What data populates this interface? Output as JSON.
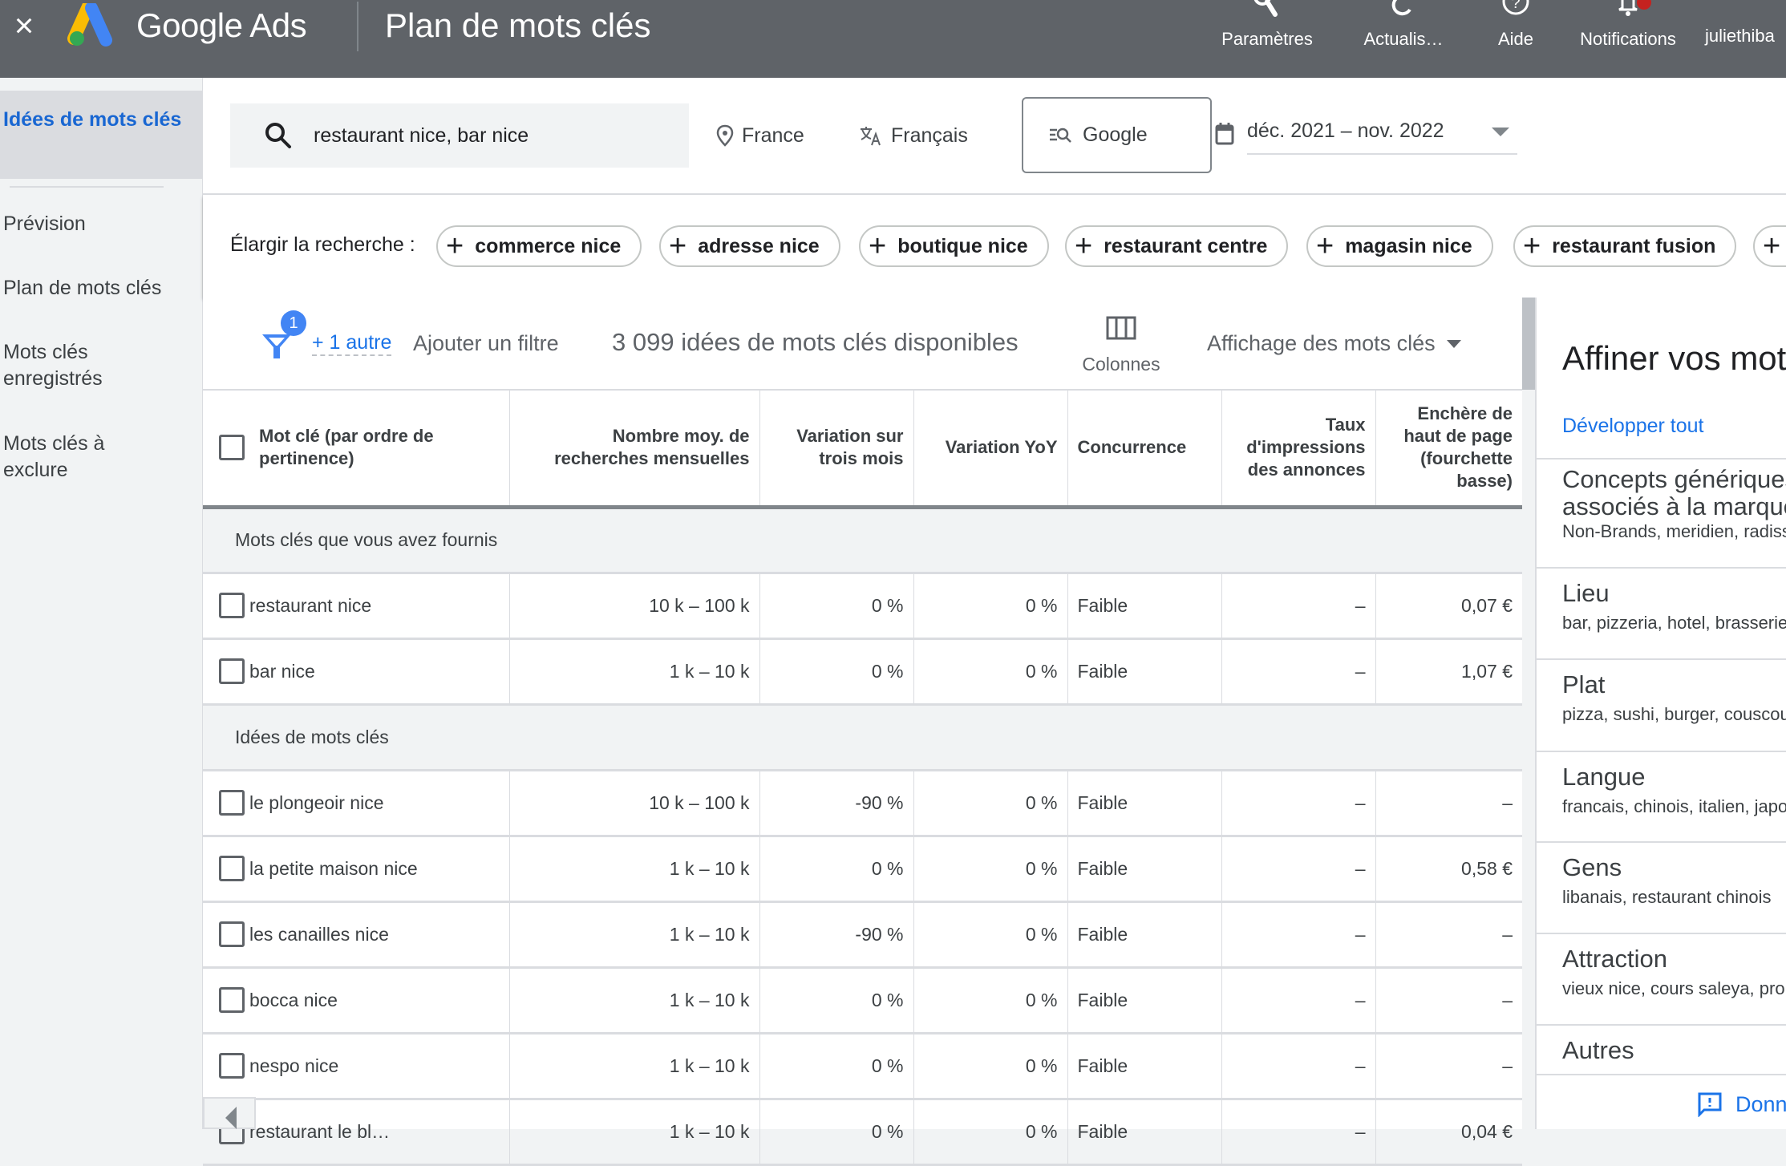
{
  "topbar": {
    "close_label": "×",
    "brand": "Google Ads",
    "page_title": "Plan de mots clés",
    "actions": [
      {
        "label": "Paramètres",
        "icon": "wrench-icon"
      },
      {
        "label": "Actualis…",
        "icon": "refresh-icon"
      },
      {
        "label": "Aide",
        "icon": "help-icon"
      },
      {
        "label": "Notifications",
        "icon": "bell-icon"
      }
    ],
    "user": "juliethiba"
  },
  "sidebar": {
    "items": [
      {
        "label": "Idées de mots clés",
        "active": true
      },
      {
        "label": "Prévision",
        "active": false
      },
      {
        "label": "Plan de mots clés",
        "active": false
      },
      {
        "label": "Mots clés enregistrés",
        "active": false
      },
      {
        "label": "Mots clés à exclure",
        "active": false
      }
    ]
  },
  "search": {
    "query": "restaurant nice, bar nice",
    "location": "France",
    "language": "Français",
    "engine": "Google",
    "date_range": "déc. 2021 – nov. 2022"
  },
  "broaden": {
    "label": "Élargir la recherche :",
    "chips": [
      "commerce nice",
      "adresse nice",
      "boutique nice",
      "restaurant centre",
      "magasin nice",
      "restaurant fusion",
      ""
    ]
  },
  "toolbar": {
    "filter_count": "1",
    "more_filter": "+ 1 autre",
    "add_filter": "Ajouter un filtre",
    "count_text": "3 099 idées de mots clés disponibles",
    "columns_label": "Colonnes",
    "view_label": "Affichage des mots clés"
  },
  "table": {
    "headers": [
      "Mot clé (par ordre de pertinence)",
      "Nombre moy. de recherches mensuelles",
      "Variation sur trois mois",
      "Variation YoY",
      "Concurrence",
      "Taux d'impressions des annonces",
      "Enchère de haut de page (fourchette basse)"
    ],
    "groups": [
      {
        "title": "Mots clés que vous avez fournis",
        "rows": [
          [
            "restaurant nice",
            "10 k – 100 k",
            "0 %",
            "0 %",
            "Faible",
            "–",
            "0,07 €"
          ],
          [
            "bar nice",
            "1 k – 10 k",
            "0 %",
            "0 %",
            "Faible",
            "–",
            "1,07 €"
          ]
        ]
      },
      {
        "title": "Idées de mots clés",
        "rows": [
          [
            "le plongeoir nice",
            "10 k – 100 k",
            "-90 %",
            "0 %",
            "Faible",
            "–",
            "–"
          ],
          [
            "la petite maison nice",
            "1 k – 10 k",
            "0 %",
            "0 %",
            "Faible",
            "–",
            "0,58 €"
          ],
          [
            "les canailles nice",
            "1 k – 10 k",
            "-90 %",
            "0 %",
            "Faible",
            "–",
            "–"
          ],
          [
            "bocca nice",
            "1 k – 10 k",
            "0 %",
            "0 %",
            "Faible",
            "–",
            "–"
          ],
          [
            "nespo nice",
            "1 k – 10 k",
            "0 %",
            "0 %",
            "Faible",
            "–",
            "–"
          ],
          [
            "restaurant le bl…",
            "1 k – 10 k",
            "0 %",
            "0 %",
            "Faible",
            "–",
            "0,04 €"
          ]
        ]
      }
    ]
  },
  "refine": {
    "title": "Affiner vos mots clés",
    "expand_all": "Développer tout",
    "sections": [
      {
        "title": "Concepts génériques associés à la marque",
        "items": "Non-Brands, meridien, radisson"
      },
      {
        "title": "Lieu",
        "items": "bar, pizzeria, hotel, brasserie"
      },
      {
        "title": "Plat",
        "items": "pizza, sushi, burger, couscous"
      },
      {
        "title": "Langue",
        "items": "francais, chinois, italien, japonais"
      },
      {
        "title": "Gens",
        "items": "libanais, restaurant chinois"
      },
      {
        "title": "Attraction",
        "items": "vieux nice, cours saleya, promenade"
      },
      {
        "title": "Autres",
        "items": ""
      }
    ],
    "feedback": "Donner votre avis"
  },
  "colors": {
    "topbar": "#5f6368",
    "accent_blue": "#1a73e8",
    "active_nav": "#1967d2",
    "notification_dot": "#c5221f",
    "logo_blue": "#4285f4",
    "logo_yellow": "#fbbc04",
    "logo_green": "#34a853"
  }
}
